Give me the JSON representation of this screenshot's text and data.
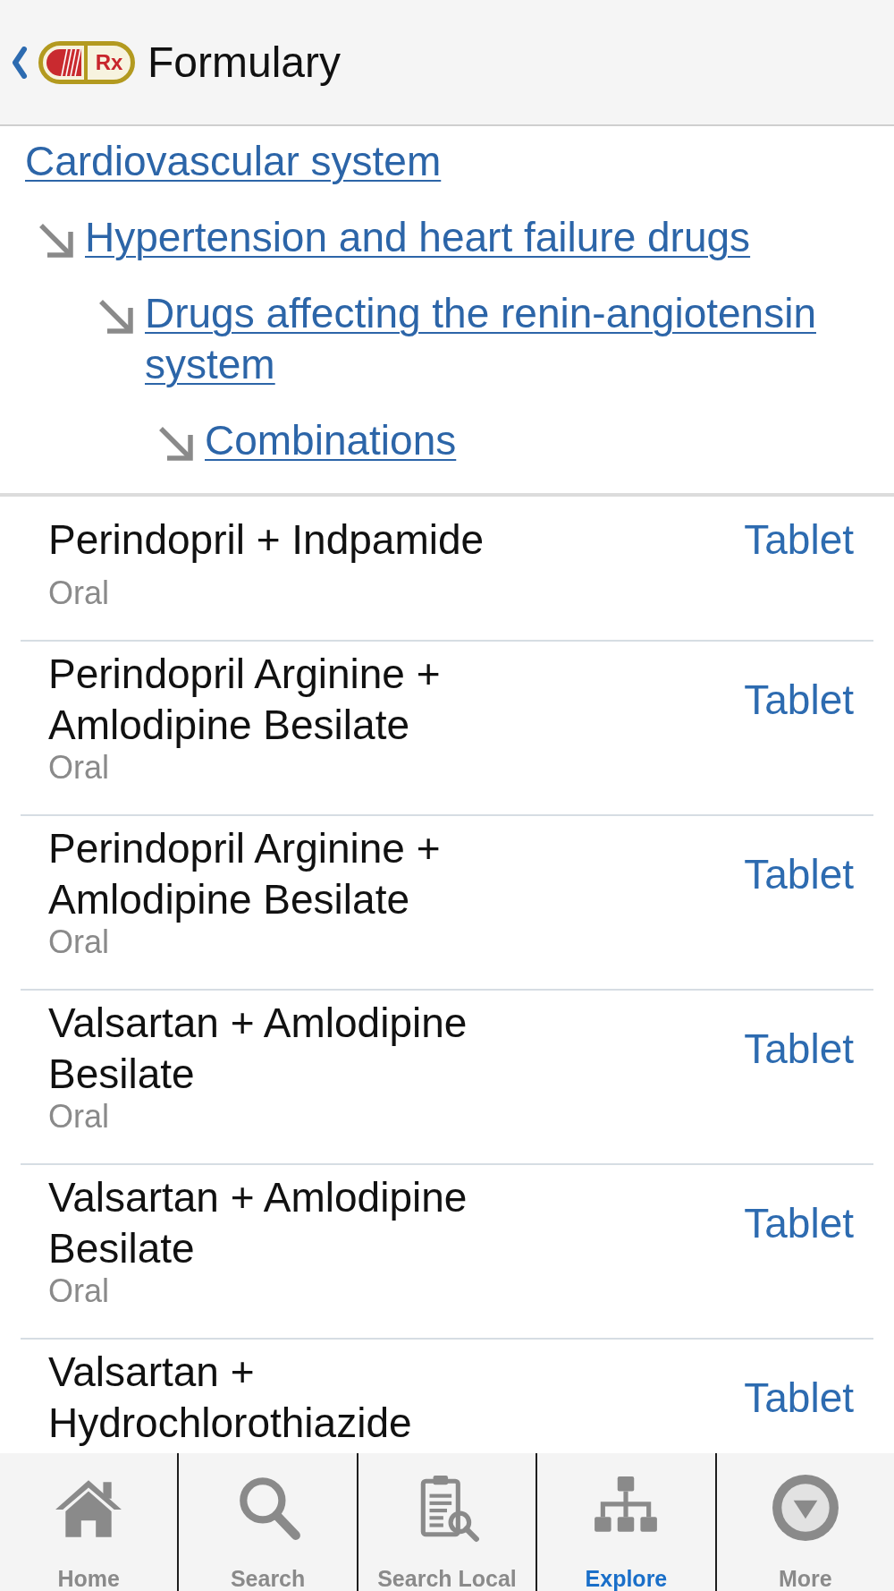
{
  "header": {
    "logo_text": "Rx",
    "title": "Formulary"
  },
  "breadcrumb": [
    {
      "label": "Cardiovascular system",
      "children": [
        {
          "label": "Hypertension and heart failure drugs",
          "children": [
            {
              "label": "Drugs affecting the renin-angiotensin system",
              "children": [
                {
                  "label": "Combinations"
                }
              ]
            }
          ]
        }
      ]
    }
  ],
  "drugs": [
    {
      "name": "Perindopril + Indpamide",
      "form": "Tablet",
      "route": "Oral"
    },
    {
      "name": "Perindopril Arginine + Amlodipine Besilate",
      "form": "Tablet",
      "route": "Oral"
    },
    {
      "name": "Perindopril Arginine + Amlodipine Besilate",
      "form": "Tablet",
      "route": "Oral"
    },
    {
      "name": "Valsartan + Amlodipine Besilate",
      "form": "Tablet",
      "route": "Oral"
    },
    {
      "name": "Valsartan + Amlodipine Besilate",
      "form": "Tablet",
      "route": "Oral"
    },
    {
      "name": "Valsartan + Hydrochlorothiazide",
      "form": "Tablet"
    }
  ],
  "nav": [
    {
      "label": "Home",
      "kind": "home",
      "selected": false
    },
    {
      "label": "Search",
      "kind": "search",
      "selected": false
    },
    {
      "label": "Search Local",
      "kind": "search_local",
      "selected": false
    },
    {
      "label": "Explore",
      "kind": "explore",
      "selected": true
    },
    {
      "label": "More",
      "kind": "more",
      "selected": false
    }
  ]
}
